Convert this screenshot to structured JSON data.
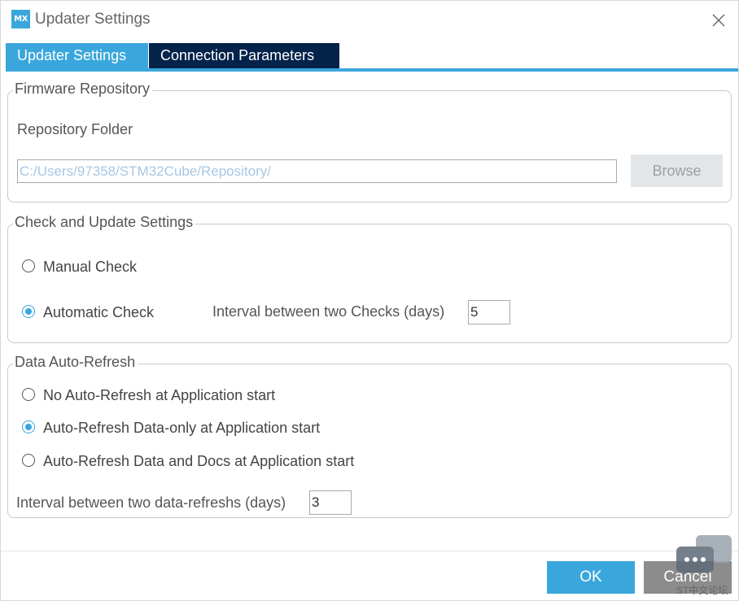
{
  "window": {
    "logo_text": "MX",
    "title": "Updater Settings"
  },
  "tabs": [
    {
      "label": "Updater Settings",
      "active": true
    },
    {
      "label": "Connection Parameters",
      "active": false
    }
  ],
  "firmware_repository": {
    "legend": "Firmware Repository",
    "folder_label": "Repository Folder",
    "folder_value": "C:/Users/97358/STM32Cube/Repository/",
    "browse_label": "Browse"
  },
  "check_update": {
    "legend": "Check and Update Settings",
    "options": [
      {
        "label": "Manual Check",
        "checked": false
      },
      {
        "label": "Automatic Check",
        "checked": true
      }
    ],
    "interval_label": "Interval between two Checks (days)",
    "interval_value": "5"
  },
  "auto_refresh": {
    "legend": "Data Auto-Refresh",
    "options": [
      {
        "label": "No Auto-Refresh at Application start",
        "checked": false
      },
      {
        "label": "Auto-Refresh Data-only at Application start",
        "checked": true
      },
      {
        "label": "Auto-Refresh Data and Docs at Application start",
        "checked": false
      }
    ],
    "interval_label": "Interval between two data-refreshs (days)",
    "interval_value": "3"
  },
  "footer": {
    "ok_label": "OK",
    "cancel_label": "Cancel"
  },
  "watermark": {
    "text": "ST中文论坛",
    "icon": "chat-bubbles-icon"
  },
  "colors": {
    "accent": "#3aa7dc",
    "tab_dark": "#03234b",
    "cancel_gray": "#8c8c8c"
  }
}
